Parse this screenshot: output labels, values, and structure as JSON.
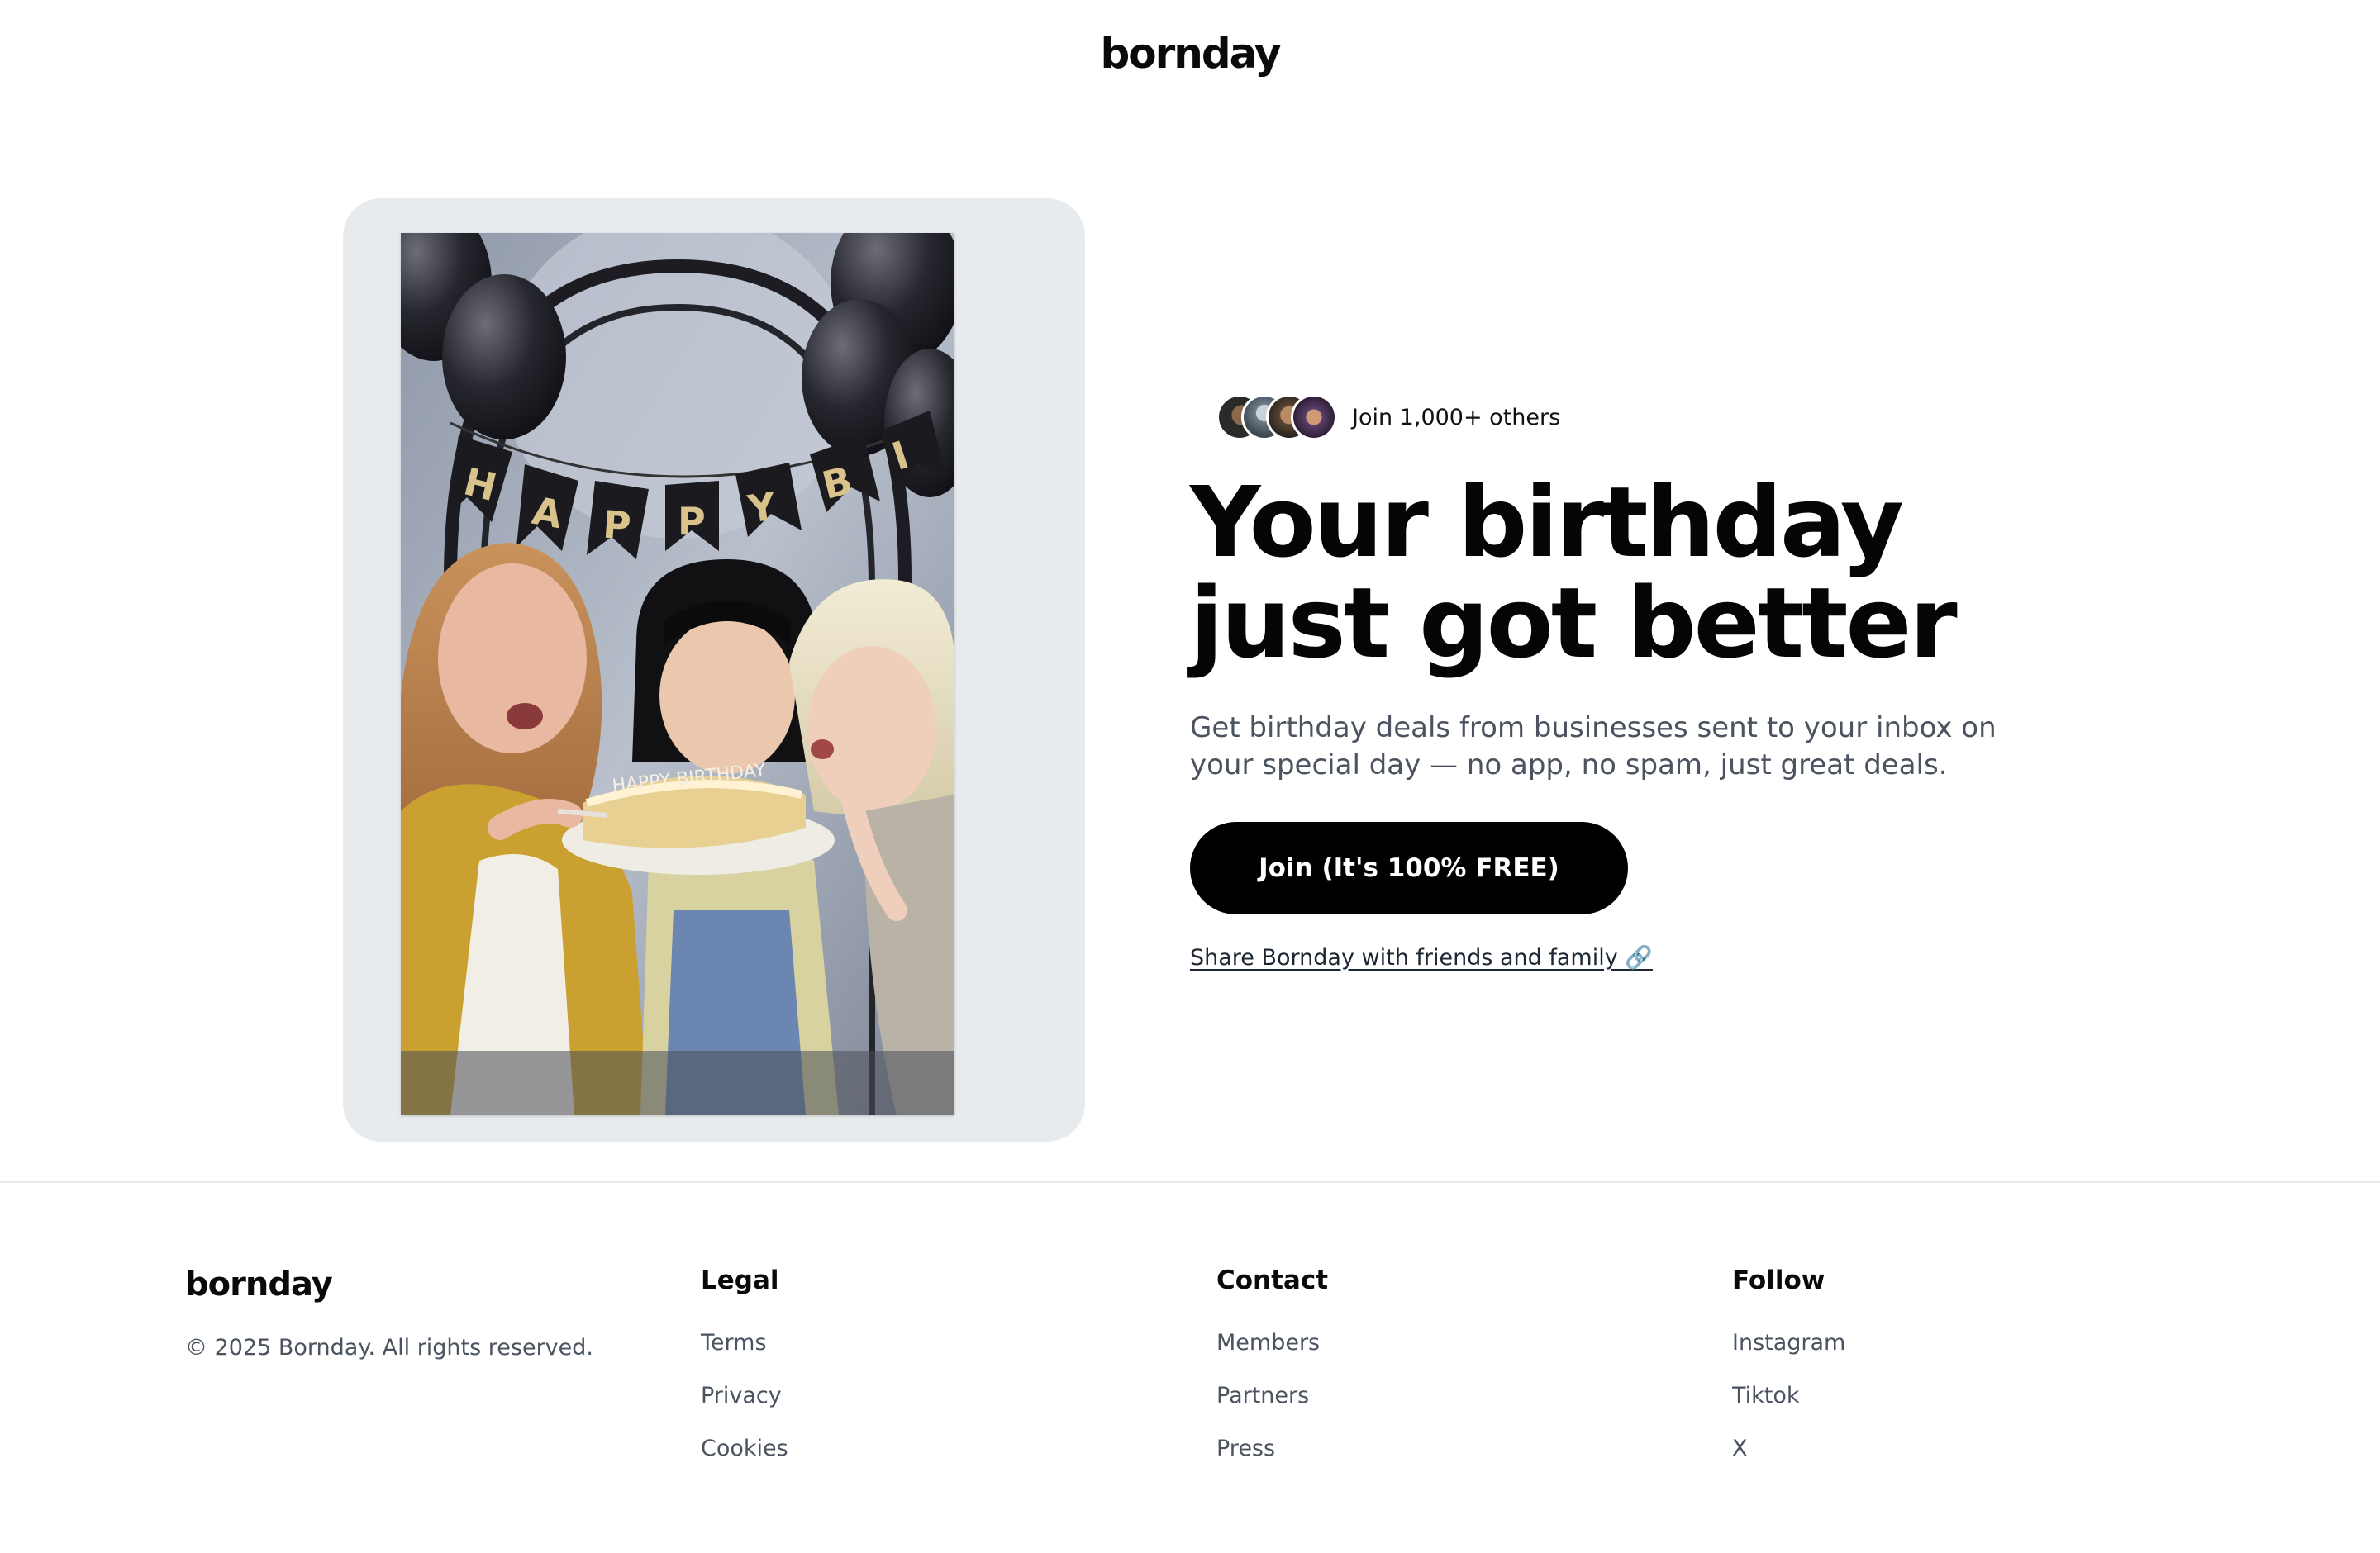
{
  "header": {
    "logo_text": "bornday"
  },
  "hero": {
    "social_proof": {
      "text": "Join 1,000+ others",
      "avatars": [
        "avatar-1",
        "avatar-2",
        "avatar-3",
        "avatar-4"
      ]
    },
    "title": "Your birthday just got better",
    "subtitle": "Get birthday deals from businesses sent to your inbox on your special day — no app, no spam, just great deals.",
    "cta_label": "Join (It's 100% FREE)",
    "share_label": "Share Bornday with friends and family 🔗",
    "image": {
      "description_icon": "birthday-photo",
      "banner_letters": [
        "H",
        "A",
        "P",
        "P",
        "Y",
        "B"
      ]
    }
  },
  "footer": {
    "logo_text": "bornday",
    "copyright": "© 2025 Bornday. All rights reserved.",
    "columns": [
      {
        "heading": "Legal",
        "links": [
          "Terms",
          "Privacy",
          "Cookies"
        ]
      },
      {
        "heading": "Contact",
        "links": [
          "Members",
          "Partners",
          "Press"
        ]
      },
      {
        "heading": "Follow",
        "links": [
          "Instagram",
          "Tiktok",
          "X"
        ]
      }
    ]
  },
  "colors": {
    "background": "#ffffff",
    "text_primary": "#050505",
    "text_secondary": "#4b5360",
    "button_bg": "#000000",
    "button_text": "#ffffff",
    "card_bg": "#e7ebee",
    "divider": "#e8e8e8"
  }
}
